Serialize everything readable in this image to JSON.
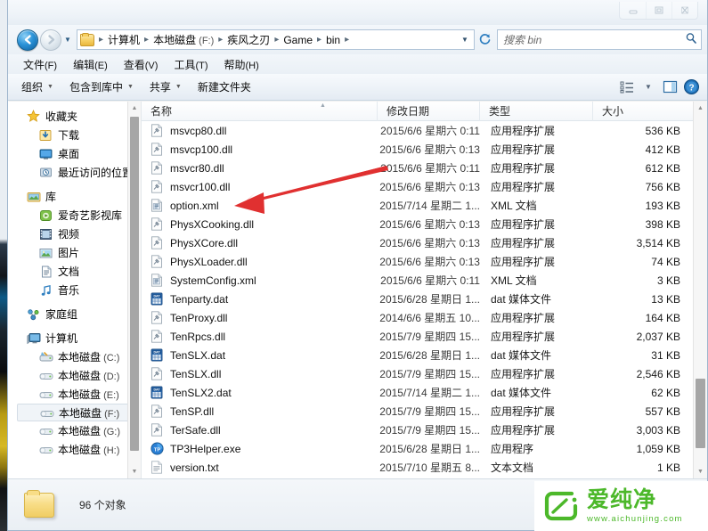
{
  "window": {
    "controls": [
      {
        "name": "minimize",
        "glyph": "minimize-icon"
      },
      {
        "name": "maximize",
        "glyph": "maximize-icon"
      },
      {
        "name": "close",
        "glyph": "close-icon"
      }
    ]
  },
  "address": {
    "back_label": "后退",
    "forward_label": "前进",
    "history_label": "最近浏览的位置",
    "refresh_label": "刷新",
    "breadcrumbs": [
      {
        "label": "计算机",
        "suffix": ""
      },
      {
        "label": "本地磁盘",
        "suffix": " (F:)"
      },
      {
        "label": "疾风之刃",
        "suffix": ""
      },
      {
        "label": "Game",
        "suffix": ""
      },
      {
        "label": "bin",
        "suffix": ""
      }
    ]
  },
  "search": {
    "placeholder": "搜索 bin",
    "icon": "search-icon"
  },
  "menubar": {
    "items": [
      {
        "label": "文件",
        "mnemonic": "(F)"
      },
      {
        "label": "编辑",
        "mnemonic": "(E)"
      },
      {
        "label": "查看",
        "mnemonic": "(V)"
      },
      {
        "label": "工具",
        "mnemonic": "(T)"
      },
      {
        "label": "帮助",
        "mnemonic": "(H)"
      }
    ]
  },
  "commandbar": {
    "buttons": [
      {
        "label": "组织",
        "caret": true
      },
      {
        "label": "包含到库中",
        "caret": true
      },
      {
        "label": "共享",
        "caret": true
      },
      {
        "label": "新建文件夹",
        "caret": false
      }
    ],
    "view_icon": "list-view-icon",
    "view_caret": "chevron-down-icon",
    "preview_icon": "preview-pane-icon",
    "help_icon": "help-icon"
  },
  "navpane": {
    "groups": [
      {
        "header": {
          "label": "收藏夹",
          "icon": "star-icon"
        },
        "items": [
          {
            "label": "下载",
            "suffix": "",
            "icon": "downloads-icon",
            "selected": false
          },
          {
            "label": "桌面",
            "suffix": "",
            "icon": "desktop-icon",
            "selected": false
          },
          {
            "label": "最近访问的位置",
            "suffix": "",
            "icon": "recent-places-icon",
            "selected": false
          }
        ]
      },
      {
        "header": {
          "label": "库",
          "icon": "library-icon"
        },
        "items": [
          {
            "label": "爱奇艺影视库",
            "suffix": "",
            "icon": "iqiyi-icon",
            "selected": false
          },
          {
            "label": "视频",
            "suffix": "",
            "icon": "video-icon",
            "selected": false
          },
          {
            "label": "图片",
            "suffix": "",
            "icon": "pictures-icon",
            "selected": false
          },
          {
            "label": "文档",
            "suffix": "",
            "icon": "documents-icon",
            "selected": false
          },
          {
            "label": "音乐",
            "suffix": "",
            "icon": "music-icon",
            "selected": false
          }
        ]
      },
      {
        "header": {
          "label": "家庭组",
          "icon": "homegroup-icon"
        },
        "items": []
      },
      {
        "header": {
          "label": "计算机",
          "icon": "computer-icon"
        },
        "items": [
          {
            "label": "本地磁盘",
            "suffix": " (C:)",
            "icon": "system-drive-icon",
            "selected": false
          },
          {
            "label": "本地磁盘",
            "suffix": " (D:)",
            "icon": "drive-icon",
            "selected": false
          },
          {
            "label": "本地磁盘",
            "suffix": " (E:)",
            "icon": "drive-icon",
            "selected": false
          },
          {
            "label": "本地磁盘",
            "suffix": " (F:)",
            "icon": "drive-icon",
            "selected": true
          },
          {
            "label": "本地磁盘",
            "suffix": " (G:)",
            "icon": "drive-icon",
            "selected": false
          },
          {
            "label": "本地磁盘",
            "suffix": " (H:)",
            "icon": "drive-icon",
            "selected": false
          }
        ]
      }
    ]
  },
  "filelist": {
    "columns": [
      "名称",
      "修改日期",
      "类型",
      "大小"
    ],
    "sort_column": "名称",
    "sort_direction": "ascending",
    "rows": [
      {
        "name": "msvcp80.dll",
        "icon": "dll-icon",
        "date": "2015/6/6 星期六 0:11",
        "type": "应用程序扩展",
        "size": "536 KB"
      },
      {
        "name": "msvcp100.dll",
        "icon": "dll-icon",
        "date": "2015/6/6 星期六 0:13",
        "type": "应用程序扩展",
        "size": "412 KB"
      },
      {
        "name": "msvcr80.dll",
        "icon": "dll-icon",
        "date": "2015/6/6 星期六 0:11",
        "type": "应用程序扩展",
        "size": "612 KB"
      },
      {
        "name": "msvcr100.dll",
        "icon": "dll-icon",
        "date": "2015/6/6 星期六 0:13",
        "type": "应用程序扩展",
        "size": "756 KB"
      },
      {
        "name": "option.xml",
        "icon": "xml-icon",
        "date": "2015/7/14 星期二 1...",
        "type": "XML 文档",
        "size": "193 KB"
      },
      {
        "name": "PhysXCooking.dll",
        "icon": "dll-icon",
        "date": "2015/6/6 星期六 0:13",
        "type": "应用程序扩展",
        "size": "398 KB"
      },
      {
        "name": "PhysXCore.dll",
        "icon": "dll-icon",
        "date": "2015/6/6 星期六 0:13",
        "type": "应用程序扩展",
        "size": "3,514 KB"
      },
      {
        "name": "PhysXLoader.dll",
        "icon": "dll-icon",
        "date": "2015/6/6 星期六 0:13",
        "type": "应用程序扩展",
        "size": "74 KB"
      },
      {
        "name": "SystemConfig.xml",
        "icon": "xml-icon",
        "date": "2015/6/6 星期六 0:11",
        "type": "XML 文档",
        "size": "3 KB"
      },
      {
        "name": "Tenparty.dat",
        "icon": "dat-icon",
        "date": "2015/6/28 星期日 1...",
        "type": "dat 媒体文件",
        "size": "13 KB"
      },
      {
        "name": "TenProxy.dll",
        "icon": "dll-icon",
        "date": "2014/6/6 星期五 10...",
        "type": "应用程序扩展",
        "size": "164 KB"
      },
      {
        "name": "TenRpcs.dll",
        "icon": "dll-icon",
        "date": "2015/7/9 星期四 15...",
        "type": "应用程序扩展",
        "size": "2,037 KB"
      },
      {
        "name": "TenSLX.dat",
        "icon": "dat-icon",
        "date": "2015/6/28 星期日 1...",
        "type": "dat 媒体文件",
        "size": "31 KB"
      },
      {
        "name": "TenSLX.dll",
        "icon": "dll-icon",
        "date": "2015/7/9 星期四 15...",
        "type": "应用程序扩展",
        "size": "2,546 KB"
      },
      {
        "name": "TenSLX2.dat",
        "icon": "dat-icon",
        "date": "2015/7/14 星期二 1...",
        "type": "dat 媒体文件",
        "size": "62 KB"
      },
      {
        "name": "TenSP.dll",
        "icon": "dll-icon",
        "date": "2015/7/9 星期四 15...",
        "type": "应用程序扩展",
        "size": "557 KB"
      },
      {
        "name": "TerSafe.dll",
        "icon": "dll-icon",
        "date": "2015/7/9 星期四 15...",
        "type": "应用程序扩展",
        "size": "3,003 KB"
      },
      {
        "name": "TP3Helper.exe",
        "icon": "exe-icon",
        "date": "2015/6/28 星期日 1...",
        "type": "应用程序",
        "size": "1,059 KB"
      },
      {
        "name": "version.txt",
        "icon": "txt-icon",
        "date": "2015/7/10 星期五 8...",
        "type": "文本文档",
        "size": "1 KB"
      }
    ]
  },
  "status": {
    "icon": "folder-icon",
    "text": "96 个对象"
  },
  "annotation": {
    "type": "arrow",
    "color": "#e03030",
    "points_to": "option.xml"
  },
  "watermark": {
    "title": "爱纯净",
    "url": "www.aichunjing.com",
    "color": "#4cb82a"
  }
}
